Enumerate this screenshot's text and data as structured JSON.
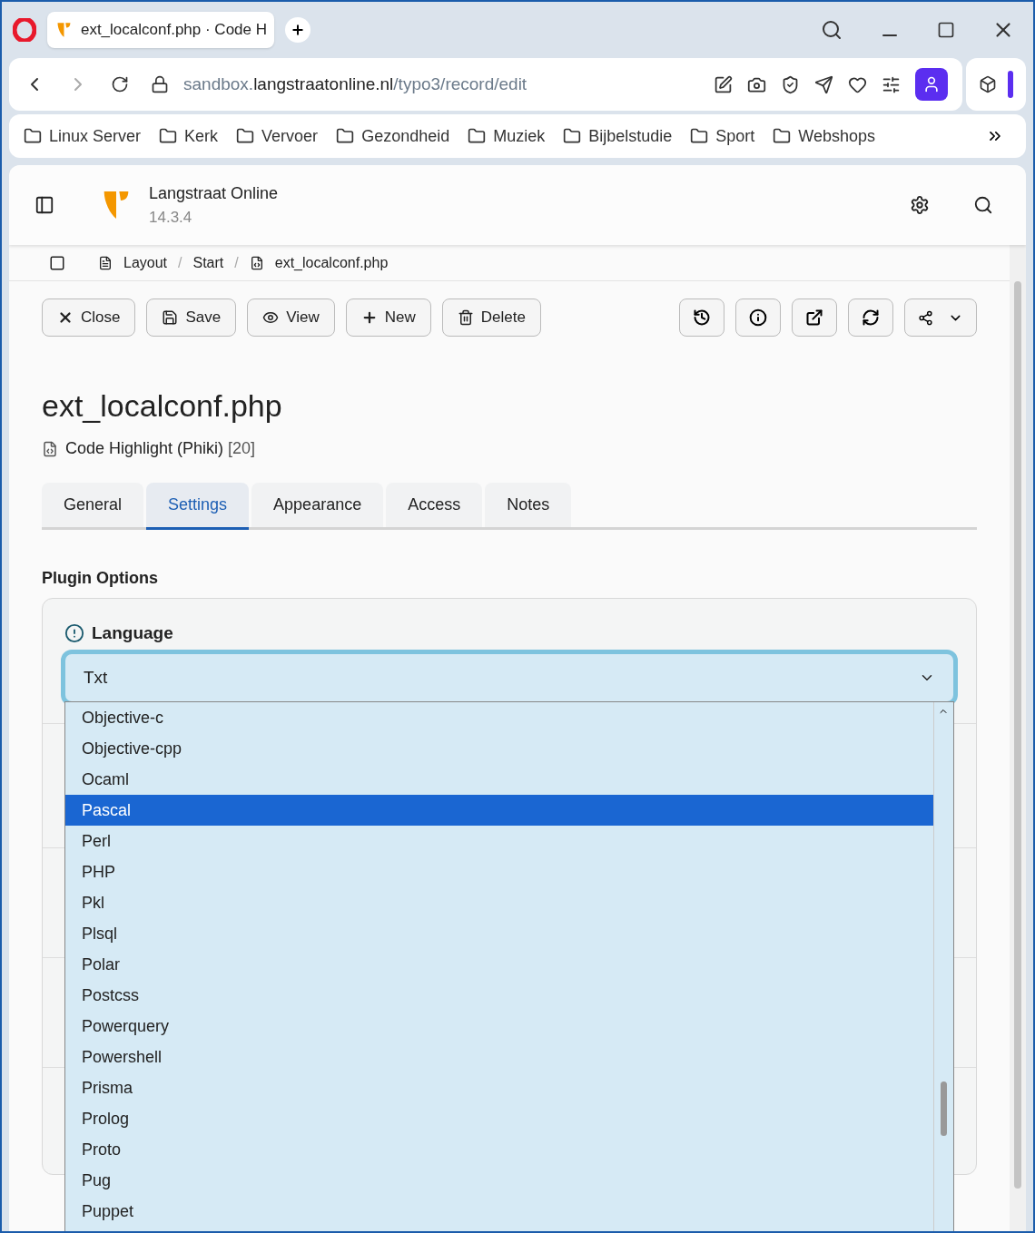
{
  "browser": {
    "tab_title": "ext_localconf.php · Code H",
    "url_host": "sandbox.",
    "url_domain": "langstraatonline.nl",
    "url_path": "/typo3/record/edit",
    "bookmarks": [
      "Linux Server",
      "Kerk",
      "Vervoer",
      "Gezondheid",
      "Muziek",
      "Bijbelstudie",
      "Sport",
      "Webshops"
    ]
  },
  "header": {
    "site_name": "Langstraat Online",
    "version": "14.3.4"
  },
  "breadcrumb": {
    "items": [
      "Layout",
      "Start",
      "ext_localconf.php"
    ],
    "separator": "/"
  },
  "toolbar": {
    "buttons": [
      {
        "label": "Close",
        "kind": "close"
      },
      {
        "label": "Save",
        "kind": "save"
      },
      {
        "label": "View",
        "kind": "view"
      },
      {
        "label": "New",
        "kind": "new"
      },
      {
        "label": "Delete",
        "kind": "delete"
      }
    ],
    "icon_buttons": [
      {
        "kind": "history"
      },
      {
        "kind": "info"
      },
      {
        "kind": "open"
      },
      {
        "kind": "reload"
      },
      {
        "kind": "share"
      }
    ]
  },
  "record": {
    "title": "ext_localconf.php",
    "type": "Code Highlight (Phiki)",
    "uid": "[20]"
  },
  "tabs": [
    {
      "label": "General",
      "selected": false
    },
    {
      "label": "Settings",
      "selected": true
    },
    {
      "label": "Appearance",
      "selected": false
    },
    {
      "label": "Access",
      "selected": false
    },
    {
      "label": "Notes",
      "selected": false
    }
  ],
  "section_title": "Plugin Options",
  "field": {
    "label": "Language",
    "value": "Txt",
    "expanded": true
  },
  "options": [
    {
      "label": "Objective-c",
      "selected": false
    },
    {
      "label": "Objective-cpp",
      "selected": false
    },
    {
      "label": "Ocaml",
      "selected": false
    },
    {
      "label": "Pascal",
      "selected": true
    },
    {
      "label": "Perl",
      "selected": false
    },
    {
      "label": "PHP",
      "selected": false
    },
    {
      "label": "Pkl",
      "selected": false
    },
    {
      "label": "Plsql",
      "selected": false
    },
    {
      "label": "Polar",
      "selected": false
    },
    {
      "label": "Postcss",
      "selected": false
    },
    {
      "label": "Powerquery",
      "selected": false
    },
    {
      "label": "Powershell",
      "selected": false
    },
    {
      "label": "Prisma",
      "selected": false
    },
    {
      "label": "Prolog",
      "selected": false
    },
    {
      "label": "Proto",
      "selected": false
    },
    {
      "label": "Pug",
      "selected": false
    },
    {
      "label": "Puppet",
      "selected": false
    }
  ]
}
